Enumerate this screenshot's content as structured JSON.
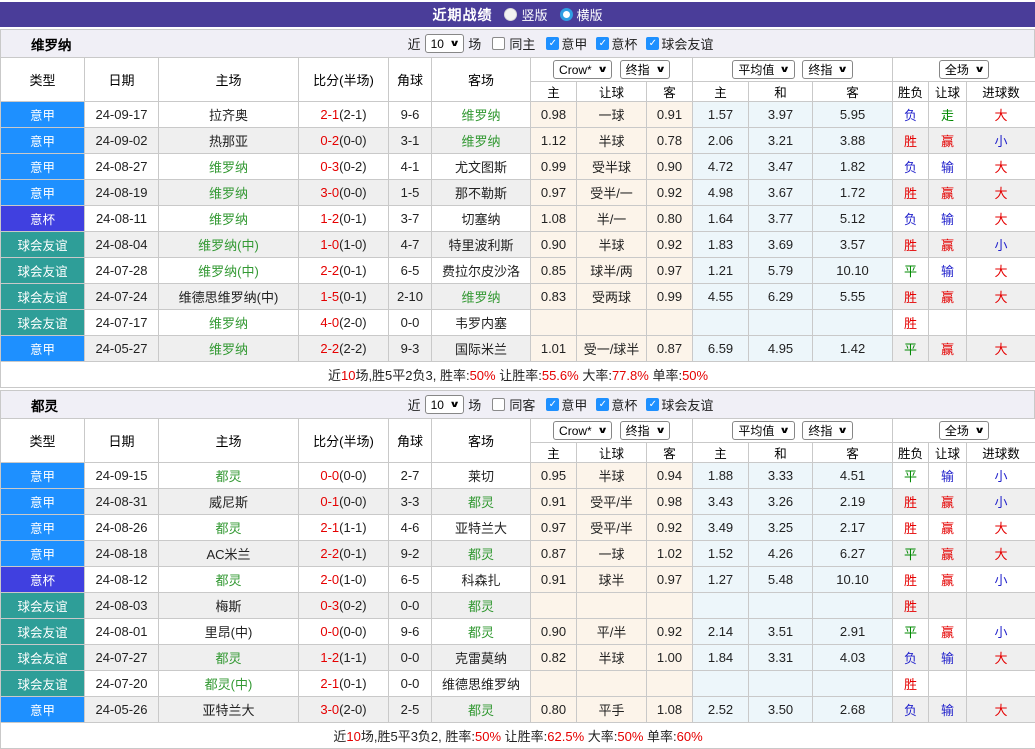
{
  "title_bar": {
    "title": "近期战绩",
    "vertical_label": "竖版",
    "horizontal_label": "横版"
  },
  "icons": {
    "check": "✓",
    "arrow": "∨"
  },
  "filter": {
    "near": "近",
    "count": "10",
    "unit": "场"
  },
  "header": {
    "type": "类型",
    "date": "日期",
    "home": "主场",
    "score": "比分(半场)",
    "corner": "角球",
    "away": "客场",
    "odds_provider": "Crow*",
    "odds_final": "终指",
    "odds_home": "主",
    "odds_handicap": "让球",
    "odds_away": "客",
    "avg_provider": "平均值",
    "avg_final": "终指",
    "avg_home": "主",
    "avg_draw": "和",
    "avg_away": "客",
    "full": "全场",
    "res_outcome": "胜负",
    "res_handicap": "让球",
    "res_goals": "进球数"
  },
  "colors": {
    "title_bar_bg": "#4a3d99",
    "serie_a": "#1e90ff",
    "coppa_italia": "#4040e0",
    "friendly": "#2e9e98",
    "win_red": "#e50000",
    "lose_blue": "#2323cc",
    "draw_green": "#008800",
    "team_green": "#339933"
  },
  "sections": [
    {
      "team": "维罗纳",
      "same_label": "同主",
      "league_labels": [
        "意甲",
        "意杯",
        "球会友谊"
      ],
      "rows": [
        {
          "type": "意甲",
          "tc": "yijia",
          "date": "24-09-17",
          "home": "拉齐奥",
          "hg": false,
          "score": "2-1",
          "half": "(2-1)",
          "corner": "9-6",
          "away": "维罗纳",
          "ag": true,
          "o": [
            "0.98",
            "一球",
            "0.91"
          ],
          "avg": [
            "1.57",
            "3.97",
            "5.95"
          ],
          "res": [
            [
              "负",
              "b"
            ],
            [
              "走",
              "g"
            ],
            [
              "大",
              "r"
            ]
          ]
        },
        {
          "type": "意甲",
          "tc": "yijia",
          "date": "24-09-02",
          "home": "热那亚",
          "hg": false,
          "score": "0-2",
          "half": "(0-0)",
          "corner": "3-1",
          "away": "维罗纳",
          "ag": true,
          "o": [
            "1.12",
            "半球",
            "0.78"
          ],
          "avg": [
            "2.06",
            "3.21",
            "3.88"
          ],
          "res": [
            [
              "胜",
              "r"
            ],
            [
              "赢",
              "r"
            ],
            [
              "小",
              "b"
            ]
          ]
        },
        {
          "type": "意甲",
          "tc": "yijia",
          "date": "24-08-27",
          "home": "维罗纳",
          "hg": true,
          "score": "0-3",
          "half": "(0-2)",
          "corner": "4-1",
          "away": "尤文图斯",
          "ag": false,
          "o": [
            "0.99",
            "受半球",
            "0.90"
          ],
          "avg": [
            "4.72",
            "3.47",
            "1.82"
          ],
          "res": [
            [
              "负",
              "b"
            ],
            [
              "输",
              "b"
            ],
            [
              "大",
              "r"
            ]
          ]
        },
        {
          "type": "意甲",
          "tc": "yijia",
          "date": "24-08-19",
          "home": "维罗纳",
          "hg": true,
          "score": "3-0",
          "half": "(0-0)",
          "corner": "1-5",
          "away": "那不勒斯",
          "ag": false,
          "o": [
            "0.97",
            "受半/一",
            "0.92"
          ],
          "avg": [
            "4.98",
            "3.67",
            "1.72"
          ],
          "res": [
            [
              "胜",
              "r"
            ],
            [
              "赢",
              "r"
            ],
            [
              "大",
              "r"
            ]
          ]
        },
        {
          "type": "意杯",
          "tc": "yibei",
          "date": "24-08-11",
          "home": "维罗纳",
          "hg": true,
          "score": "1-2",
          "half": "(0-1)",
          "corner": "3-7",
          "away": "切塞纳",
          "ag": false,
          "o": [
            "1.08",
            "半/一",
            "0.80"
          ],
          "avg": [
            "1.64",
            "3.77",
            "5.12"
          ],
          "res": [
            [
              "负",
              "b"
            ],
            [
              "输",
              "b"
            ],
            [
              "大",
              "r"
            ]
          ]
        },
        {
          "type": "球会友谊",
          "tc": "youyi",
          "date": "24-08-04",
          "home": "维罗纳(中)",
          "hg": true,
          "score": "1-0",
          "half": "(1-0)",
          "corner": "4-7",
          "away": "特里波利斯",
          "ag": false,
          "o": [
            "0.90",
            "半球",
            "0.92"
          ],
          "avg": [
            "1.83",
            "3.69",
            "3.57"
          ],
          "res": [
            [
              "胜",
              "r"
            ],
            [
              "赢",
              "r"
            ],
            [
              "小",
              "b"
            ]
          ]
        },
        {
          "type": "球会友谊",
          "tc": "youyi",
          "date": "24-07-28",
          "home": "维罗纳(中)",
          "hg": true,
          "score": "2-2",
          "half": "(0-1)",
          "corner": "6-5",
          "away": "费拉尔皮沙洛",
          "ag": false,
          "o": [
            "0.85",
            "球半/两",
            "0.97"
          ],
          "avg": [
            "1.21",
            "5.79",
            "10.10"
          ],
          "res": [
            [
              "平",
              "g"
            ],
            [
              "输",
              "b"
            ],
            [
              "大",
              "r"
            ]
          ]
        },
        {
          "type": "球会友谊",
          "tc": "youyi",
          "date": "24-07-24",
          "home": "维德思维罗纳(中)",
          "hg": false,
          "score": "1-5",
          "half": "(0-1)",
          "corner": "2-10",
          "away": "维罗纳",
          "ag": true,
          "o": [
            "0.83",
            "受两球",
            "0.99"
          ],
          "avg": [
            "4.55",
            "6.29",
            "5.55"
          ],
          "res": [
            [
              "胜",
              "r"
            ],
            [
              "赢",
              "r"
            ],
            [
              "大",
              "r"
            ]
          ]
        },
        {
          "type": "球会友谊",
          "tc": "youyi",
          "date": "24-07-17",
          "home": "维罗纳",
          "hg": true,
          "score": "4-0",
          "half": "(2-0)",
          "corner": "0-0",
          "away": "韦罗内塞",
          "ag": false,
          "o": [
            "",
            "",
            ""
          ],
          "avg": [
            "",
            "",
            ""
          ],
          "res": [
            [
              "胜",
              "r"
            ],
            [
              "",
              ""
            ],
            [
              "",
              ""
            ]
          ]
        },
        {
          "type": "意甲",
          "tc": "yijia",
          "date": "24-05-27",
          "home": "维罗纳",
          "hg": true,
          "score": "2-2",
          "half": "(2-2)",
          "corner": "9-3",
          "away": "国际米兰",
          "ag": false,
          "o": [
            "1.01",
            "受一/球半",
            "0.87"
          ],
          "avg": [
            "6.59",
            "4.95",
            "1.42"
          ],
          "res": [
            [
              "平",
              "g"
            ],
            [
              "赢",
              "r"
            ],
            [
              "大",
              "r"
            ]
          ]
        }
      ],
      "summary": [
        [
          "近",
          ""
        ],
        [
          "10",
          "r"
        ],
        [
          "场,胜5平2负3, 胜率:",
          ""
        ],
        [
          "50%",
          "r"
        ],
        [
          " 让胜率:",
          ""
        ],
        [
          "55.6%",
          "r"
        ],
        [
          " 大率:",
          ""
        ],
        [
          "77.8%",
          "r"
        ],
        [
          " 单率:",
          ""
        ],
        [
          "50%",
          "r"
        ]
      ]
    },
    {
      "team": "都灵",
      "same_label": "同客",
      "league_labels": [
        "意甲",
        "意杯",
        "球会友谊"
      ],
      "rows": [
        {
          "type": "意甲",
          "tc": "yijia",
          "date": "24-09-15",
          "home": "都灵",
          "hg": true,
          "score": "0-0",
          "half": "(0-0)",
          "corner": "2-7",
          "away": "莱切",
          "ag": false,
          "o": [
            "0.95",
            "半球",
            "0.94"
          ],
          "avg": [
            "1.88",
            "3.33",
            "4.51"
          ],
          "res": [
            [
              "平",
              "g"
            ],
            [
              "输",
              "b"
            ],
            [
              "小",
              "b"
            ]
          ]
        },
        {
          "type": "意甲",
          "tc": "yijia",
          "date": "24-08-31",
          "home": "威尼斯",
          "hg": false,
          "score": "0-1",
          "half": "(0-0)",
          "corner": "3-3",
          "away": "都灵",
          "ag": true,
          "o": [
            "0.91",
            "受平/半",
            "0.98"
          ],
          "avg": [
            "3.43",
            "3.26",
            "2.19"
          ],
          "res": [
            [
              "胜",
              "r"
            ],
            [
              "赢",
              "r"
            ],
            [
              "小",
              "b"
            ]
          ]
        },
        {
          "type": "意甲",
          "tc": "yijia",
          "date": "24-08-26",
          "home": "都灵",
          "hg": true,
          "score": "2-1",
          "half": "(1-1)",
          "corner": "4-6",
          "away": "亚特兰大",
          "ag": false,
          "o": [
            "0.97",
            "受平/半",
            "0.92"
          ],
          "avg": [
            "3.49",
            "3.25",
            "2.17"
          ],
          "res": [
            [
              "胜",
              "r"
            ],
            [
              "赢",
              "r"
            ],
            [
              "大",
              "r"
            ]
          ]
        },
        {
          "type": "意甲",
          "tc": "yijia",
          "date": "24-08-18",
          "home": "AC米兰",
          "hg": false,
          "score": "2-2",
          "half": "(0-1)",
          "corner": "9-2",
          "away": "都灵",
          "ag": true,
          "o": [
            "0.87",
            "一球",
            "1.02"
          ],
          "avg": [
            "1.52",
            "4.26",
            "6.27"
          ],
          "res": [
            [
              "平",
              "g"
            ],
            [
              "赢",
              "r"
            ],
            [
              "大",
              "r"
            ]
          ]
        },
        {
          "type": "意杯",
          "tc": "yibei",
          "date": "24-08-12",
          "home": "都灵",
          "hg": true,
          "score": "2-0",
          "half": "(1-0)",
          "corner": "6-5",
          "away": "科森扎",
          "ag": false,
          "o": [
            "0.91",
            "球半",
            "0.97"
          ],
          "avg": [
            "1.27",
            "5.48",
            "10.10"
          ],
          "res": [
            [
              "胜",
              "r"
            ],
            [
              "赢",
              "r"
            ],
            [
              "小",
              "b"
            ]
          ]
        },
        {
          "type": "球会友谊",
          "tc": "youyi",
          "date": "24-08-03",
          "home": "梅斯",
          "hg": false,
          "score": "0-3",
          "half": "(0-2)",
          "corner": "0-0",
          "away": "都灵",
          "ag": true,
          "o": [
            "",
            "",
            ""
          ],
          "avg": [
            "",
            "",
            ""
          ],
          "res": [
            [
              "胜",
              "r"
            ],
            [
              "",
              ""
            ],
            [
              "",
              ""
            ]
          ]
        },
        {
          "type": "球会友谊",
          "tc": "youyi",
          "date": "24-08-01",
          "home": "里昂(中)",
          "hg": false,
          "score": "0-0",
          "half": "(0-0)",
          "corner": "9-6",
          "away": "都灵",
          "ag": true,
          "o": [
            "0.90",
            "平/半",
            "0.92"
          ],
          "avg": [
            "2.14",
            "3.51",
            "2.91"
          ],
          "res": [
            [
              "平",
              "g"
            ],
            [
              "赢",
              "r"
            ],
            [
              "小",
              "b"
            ]
          ]
        },
        {
          "type": "球会友谊",
          "tc": "youyi",
          "date": "24-07-27",
          "home": "都灵",
          "hg": true,
          "score": "1-2",
          "half": "(1-1)",
          "corner": "0-0",
          "away": "克雷莫纳",
          "ag": false,
          "o": [
            "0.82",
            "半球",
            "1.00"
          ],
          "avg": [
            "1.84",
            "3.31",
            "4.03"
          ],
          "res": [
            [
              "负",
              "b"
            ],
            [
              "输",
              "b"
            ],
            [
              "大",
              "r"
            ]
          ]
        },
        {
          "type": "球会友谊",
          "tc": "youyi",
          "date": "24-07-20",
          "home": "都灵(中)",
          "hg": true,
          "score": "2-1",
          "half": "(0-1)",
          "corner": "0-0",
          "away": "维德思维罗纳",
          "ag": false,
          "o": [
            "",
            "",
            ""
          ],
          "avg": [
            "",
            "",
            ""
          ],
          "res": [
            [
              "胜",
              "r"
            ],
            [
              "",
              ""
            ],
            [
              "",
              ""
            ]
          ]
        },
        {
          "type": "意甲",
          "tc": "yijia",
          "date": "24-05-26",
          "home": "亚特兰大",
          "hg": false,
          "score": "3-0",
          "half": "(2-0)",
          "corner": "2-5",
          "away": "都灵",
          "ag": true,
          "o": [
            "0.80",
            "平手",
            "1.08"
          ],
          "avg": [
            "2.52",
            "3.50",
            "2.68"
          ],
          "res": [
            [
              "负",
              "b"
            ],
            [
              "输",
              "b"
            ],
            [
              "大",
              "r"
            ]
          ]
        }
      ],
      "summary": [
        [
          "近",
          ""
        ],
        [
          "10",
          "r"
        ],
        [
          "场,胜5平3负2, 胜率:",
          ""
        ],
        [
          "50%",
          "r"
        ],
        [
          " 让胜率:",
          ""
        ],
        [
          "62.5%",
          "r"
        ],
        [
          " 大率:",
          ""
        ],
        [
          "50%",
          "r"
        ],
        [
          " 单率:",
          ""
        ],
        [
          "60%",
          "r"
        ]
      ]
    }
  ]
}
